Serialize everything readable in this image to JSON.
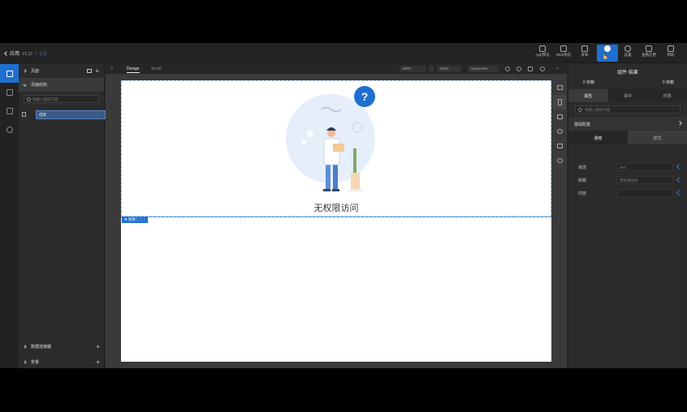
{
  "header": {
    "app_name": "应用",
    "version": "V1.32",
    "crumb": "主页",
    "buttons": [
      {
        "label": "App预览",
        "icon": "mobile-preview-icon"
      },
      {
        "label": "Web预览",
        "icon": "monitor-preview-icon"
      },
      {
        "label": "发布",
        "icon": "publish-icon"
      },
      {
        "label": "",
        "icon": "shield-icon"
      },
      {
        "label": "设置",
        "icon": "gear-icon"
      },
      {
        "label": "查看应用",
        "icon": "view-app-icon"
      },
      {
        "label": "帮助",
        "icon": "help-icon"
      }
    ]
  },
  "left_panel": {
    "pages_label": "页面",
    "structure_label": "页面结构",
    "search_placeholder": "请输入搜索内容",
    "tree_item": "结果",
    "data_connector_label": "数据连接器",
    "variables_label": "变量"
  },
  "canvas": {
    "tab_design": "Design",
    "tab_script": "Script",
    "zoom1": "100%",
    "zoom2": "100%",
    "layout": "responsive",
    "result_title": "无权限访问",
    "selected_component": "结果"
  },
  "right_panel": {
    "title": "组件 结果",
    "left_count": "0 依赖",
    "right_count": "0 依赖",
    "tabs": [
      "属性",
      "事件",
      "权限"
    ],
    "search_placeholder": "请输入搜索内容",
    "section_label": "基础配置",
    "subtabs": [
      "通用",
      "样式"
    ],
    "props": [
      {
        "label": "状态",
        "value": "404"
      },
      {
        "label": "标题",
        "value": "无权限访问"
      },
      {
        "label": "内容",
        "value": ""
      }
    ]
  },
  "colors": {
    "accent": "#1f6fd0",
    "panel": "#2b2b2b",
    "illustration_bg": "#e6eefa"
  }
}
